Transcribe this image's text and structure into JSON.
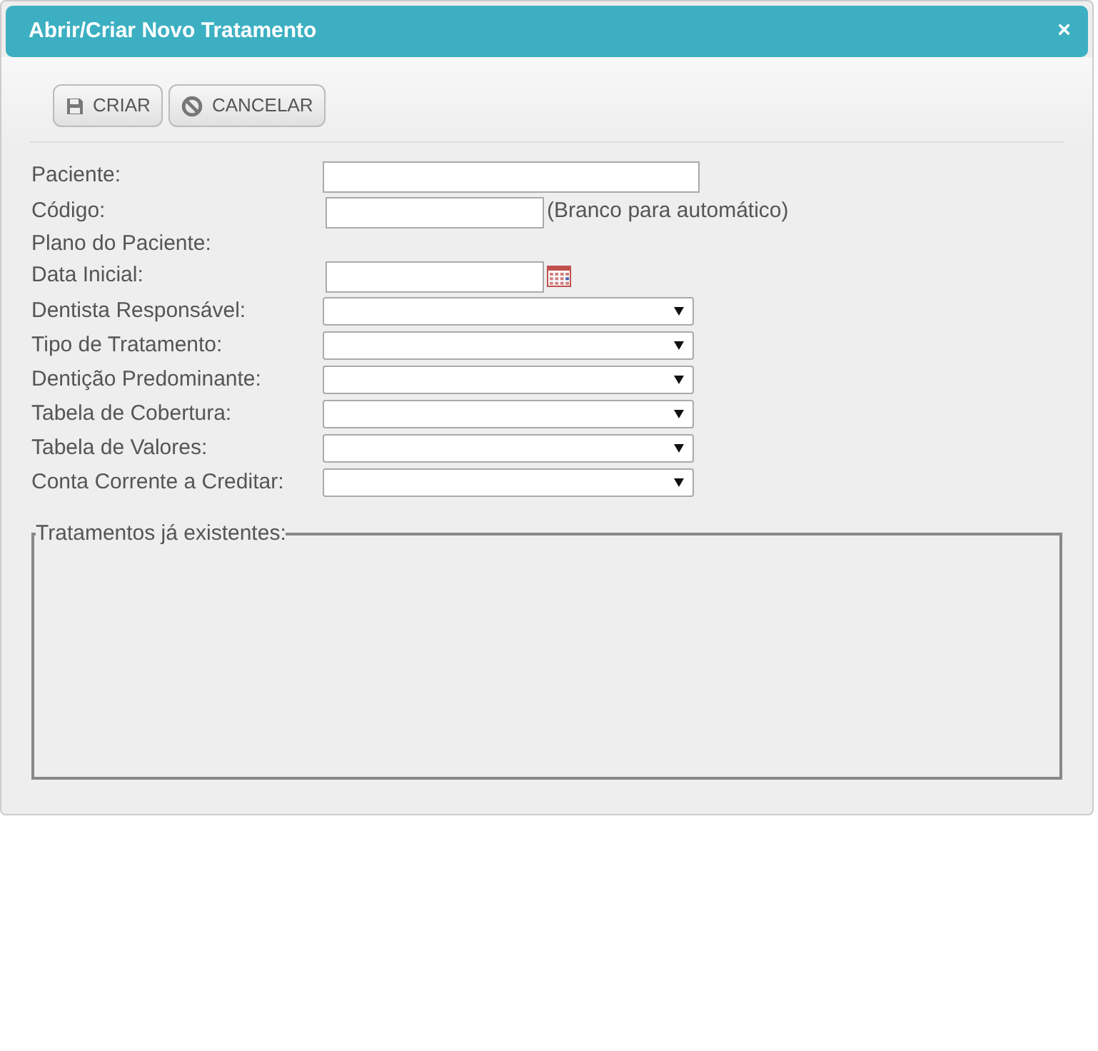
{
  "dialog": {
    "title": "Abrir/Criar Novo Tratamento",
    "close": "×"
  },
  "toolbar": [
    {
      "kind": "save",
      "label": "CRIAR"
    },
    {
      "kind": "cancel",
      "label": "CANCELAR"
    }
  ],
  "fields": [
    {
      "kind": "text",
      "label": "Paciente:"
    },
    {
      "kind": "code",
      "label": "Código:",
      "hint": "(Branco para automático)"
    },
    {
      "kind": "info",
      "label": "Plano do Paciente:"
    },
    {
      "kind": "date",
      "label": "Data Inicial:"
    },
    {
      "kind": "select",
      "label": "Dentista Responsável:"
    },
    {
      "kind": "select",
      "label": "Tipo de Tratamento:"
    },
    {
      "kind": "select",
      "label": "Dentição Predominante:"
    },
    {
      "kind": "select",
      "label": "Tabela de Cobertura:"
    },
    {
      "kind": "select",
      "label": "Tabela de Valores:"
    },
    {
      "kind": "select",
      "label": "Conta Corrente a Creditar:"
    }
  ],
  "existing": {
    "legend": "Tratamentos já existentes:"
  }
}
